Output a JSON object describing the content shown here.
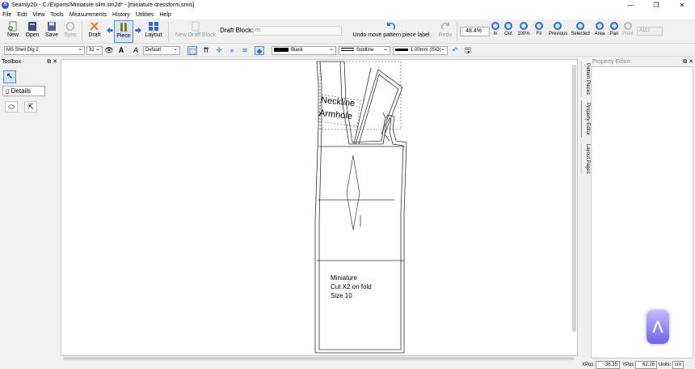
{
  "window": {
    "title": "Seamly2D - C:/Exports/Miniature slim.sm2d* - [miniature dressform.smis]",
    "controls": [
      "—",
      "❐",
      "✕"
    ]
  },
  "menu": [
    "File",
    "Edit",
    "View",
    "Tools",
    "Measurements",
    "History",
    "Utilities",
    "Help"
  ],
  "toolbar": {
    "new": "New",
    "open": "Open",
    "save": "Save",
    "sync": "Sync",
    "draft": "Draft",
    "piece": "Piece",
    "layout": "Layout",
    "new_draft_block": "New Draft Block",
    "draft_block_label": "Draft Block:",
    "draft_block_value": "m",
    "undo": "Undo move pattern piece label",
    "redo": "Redo",
    "zoom": "48.4%",
    "zoom_buttons": [
      "In",
      "Out",
      "100%",
      "Fit",
      "Previous",
      "Selected",
      "Area",
      "Pan",
      "Point"
    ],
    "grade": "A112"
  },
  "toolbar2": {
    "font": "MS Shell Dlg 2",
    "size": "32",
    "weight": "Default",
    "color": "Black",
    "line_type": "Soldline",
    "line_weight": "1.00mm (ISO)"
  },
  "toolbox": {
    "title": "Toolbox",
    "details": "Details"
  },
  "property_editor": {
    "title": "Property Editor"
  },
  "side_tabs": [
    "Pattern Pieces",
    "Property Editor",
    "Layout Pages"
  ],
  "pattern": {
    "label_main": [
      "Neckline",
      "Armhole"
    ],
    "label_piece": [
      "Miniature",
      "Cut X2 on fold",
      "Size 10"
    ]
  },
  "status": {
    "xpos_label": "XPos:",
    "xpos": "-36.35",
    "ypos_label": "YPos:",
    "ypos": "62.26",
    "units_label": "Units:",
    "units": "cm"
  }
}
